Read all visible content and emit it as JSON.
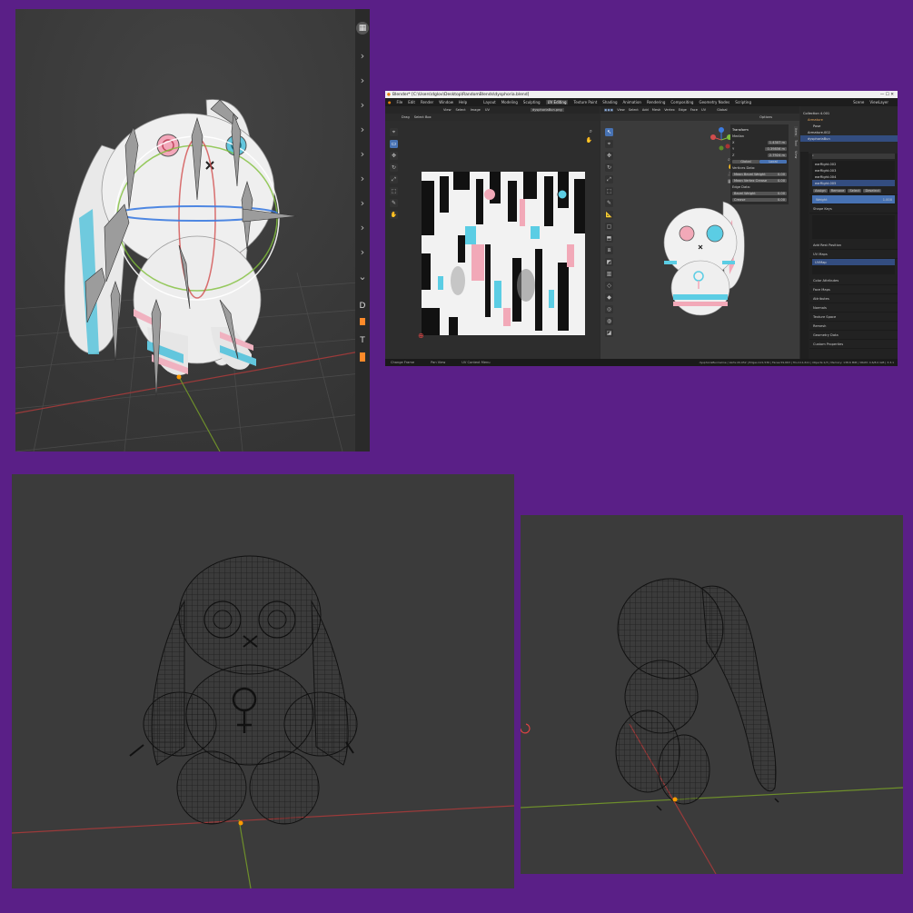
{
  "top_left_viewport": {
    "sidebar_chevrons": [
      "›",
      "›",
      "›",
      "›",
      "›",
      "›",
      "›",
      "›",
      "›",
      "⌄"
    ],
    "sidebar_letters": [
      "D",
      "T"
    ]
  },
  "blender_window": {
    "title": "Blender* [C:\\Users\\dglov\\Desktop\\RandomBlends\\dysphoria.blend]",
    "menu": [
      "File",
      "Edit",
      "Render",
      "Window",
      "Help"
    ],
    "workspace_tabs": [
      "Layout",
      "Modeling",
      "Sculpting",
      "UV Editing",
      "Texture Paint",
      "Shading",
      "Animation",
      "Rendering",
      "Compositing",
      "Geometry Nodes",
      "Scripting"
    ],
    "active_tab": "UV Editing",
    "scene_label": "Scene",
    "view_layer_label": "ViewLayer",
    "uv_editor": {
      "header": [
        "View",
        "Select",
        "Image",
        "UV"
      ],
      "image_name": "dysphoriaBun.png",
      "subheader": [
        "Drag",
        "Select Box"
      ]
    },
    "viewport_3d": {
      "header": [
        "View",
        "Select",
        "Add",
        "Mesh",
        "Vertex",
        "Edge",
        "Face",
        "UV"
      ],
      "orientation": "Global",
      "options_label": "Options",
      "side_tabs": [
        "Item",
        "Tool",
        "View"
      ],
      "n_panel": {
        "title": "Transform",
        "median_label": "Median",
        "x_label": "X",
        "x_value": "1.4307 m",
        "y_label": "Y",
        "y_value": "0.39856 m",
        "z_label": "Z",
        "z_value": "2.7924 m",
        "global": "Global",
        "local": "Local",
        "vertices_data": "Vertices Data:",
        "mean_bevel_weight": "Mean Bevel Weight",
        "mean_bevel_weight_value": "0.00",
        "mean_vertex_crease": "Mean Vertex Crease",
        "mean_vertex_crease_value": "0.00",
        "edges_data": "Edge Data:",
        "bevel_weight": "Bevel Weight",
        "bevel_weight_value": "0.00",
        "crease": "Crease",
        "crease_value": "0.00"
      }
    },
    "outliner": {
      "rows": [
        "Collection 4.001",
        "Armature",
        "Pose",
        "Armature.002",
        "dysphoriaBun"
      ],
      "search_placeholder": ""
    },
    "properties": {
      "vertex_groups": [
        "earRight.002",
        "earRight.003",
        "earRight.004",
        "earRight.005"
      ],
      "vg_buttons": [
        "Assign",
        "Remove",
        "Select",
        "Deselect"
      ],
      "weight_label": "Weight",
      "weight_value": "1.000",
      "shape_keys": "Shape Keys",
      "add_rest_position": "Add Rest Position",
      "uv_maps": "UV Maps",
      "uv_map_name": "UVMap",
      "sections": [
        "Color Attributes",
        "Face Maps",
        "Attributes",
        "Normals",
        "Texture Space",
        "Remesh",
        "Geometry Data",
        "Custom Properties"
      ]
    },
    "status_bar": [
      "Change Frame",
      "Pan View",
      "UV Context Menu"
    ],
    "status_right": "dysphoriaBunCeline | Verts:20,952 | Edges:121,536 | Faces:59,663 | Tris:111,611 | Objects:1/3 | Memory: 138.6 MiB | VRAM: 4.6/8.0 GiB | 3.3.1"
  },
  "colors": {
    "frame_purple": "#5a1f87",
    "viewport_gray": "#3a3a3a",
    "trans_blue": "#5bcde4",
    "trans_pink": "#f2a9b8",
    "active_blue": "#4772b3"
  }
}
